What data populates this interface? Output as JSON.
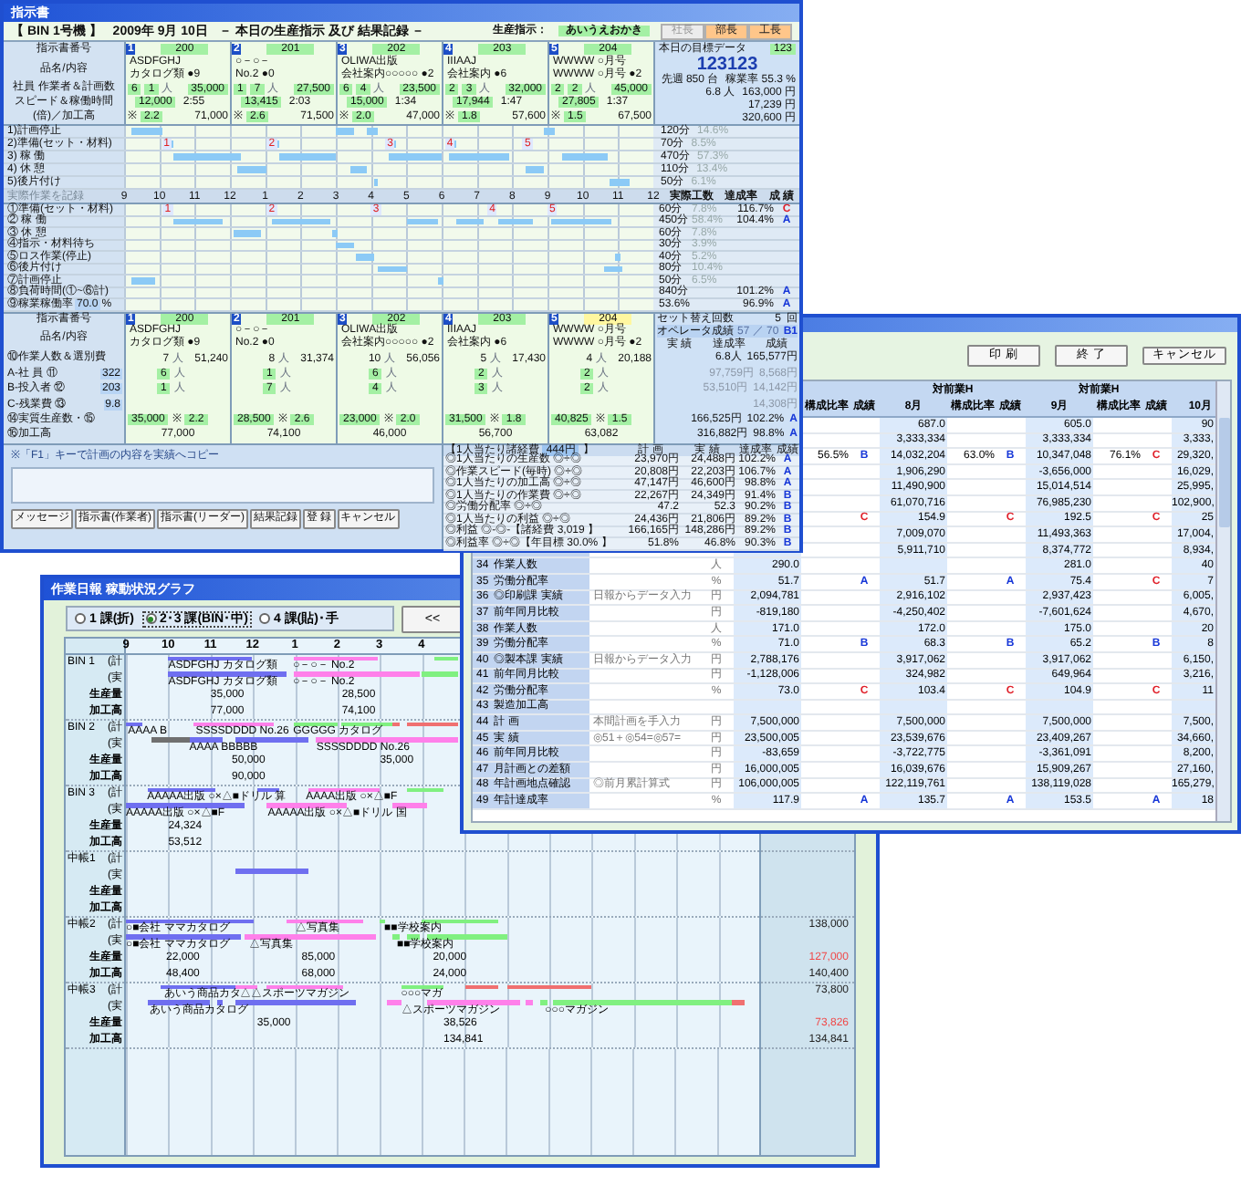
{
  "instruction_window": {
    "title": "指示書",
    "machine": "【 BIN 1号機 】",
    "date": "2009年 9月 10日",
    "heading": "－ 本日の生産指示 及び 結果記録 －",
    "director_label": "生産指示：",
    "director": "あいうえおかき",
    "approvals": [
      {
        "label": "社長",
        "selected": false
      },
      {
        "label": "部長",
        "selected": true
      },
      {
        "label": "工長",
        "selected": true
      }
    ],
    "plan": {
      "labels": [
        "指示書番号",
        "品名/内容",
        "社員 作業者＆計画数",
        "スピード＆稼働時間",
        "(倍)／加工高"
      ],
      "jobs": [
        {
          "no": "1",
          "code": "200",
          "name": [
            "ASDFGHJ",
            "カタログ類 ●9"
          ],
          "staff": "6",
          "workers": "1",
          "unit": "人",
          "quantity": "35,000",
          "speed": "12,000",
          "hours": "2:55",
          "mark": "※",
          "ratio": "2.2",
          "amount": "71,000"
        },
        {
          "no": "2",
          "code": "201",
          "name": [
            "○－○－",
            "No.2 ●0"
          ],
          "staff": "1",
          "workers": "7",
          "unit": "人",
          "quantity": "27,500",
          "speed": "13,415",
          "hours": "2:03",
          "mark": "※",
          "ratio": "2.6",
          "amount": "71,500"
        },
        {
          "no": "3",
          "code": "202",
          "name": [
            "OLIWA出版",
            "会社案内○○○○○ ●2"
          ],
          "staff": "6",
          "workers": "4",
          "unit": "人",
          "quantity": "23,500",
          "speed": "15,000",
          "hours": "1:34",
          "mark": "※",
          "ratio": "2.0",
          "amount": "47,000"
        },
        {
          "no": "4",
          "code": "203",
          "name": [
            "IIIAAJ",
            "会社案内 ●6"
          ],
          "staff": "2",
          "workers": "3",
          "unit": "人",
          "quantity": "32,000",
          "speed": "17,944",
          "hours": "1:47",
          "mark": "※",
          "ratio": "1.8",
          "amount": "57,600"
        },
        {
          "no": "5",
          "code": "204",
          "name": [
            "WWWW ○月号",
            "WWWW ○月号 ●2"
          ],
          "staff": "2",
          "workers": "2",
          "unit": "人",
          "quantity": "45,000",
          "speed": "27,805",
          "hours": "1:37",
          "mark": "※",
          "ratio": "1.5",
          "amount": "67,500"
        }
      ],
      "summary": {
        "label": "本日の目標データ",
        "code": "123",
        "value": "123123",
        "stats": [
          [
            "先週 850 台",
            "稼業率 55.3 %"
          ],
          [
            "6.8 人",
            "163,000 円"
          ],
          [
            "17,239 円"
          ],
          [
            "320,600 円"
          ]
        ]
      },
      "rows": [
        {
          "label": "1)計画停止",
          "minutes": "120分",
          "share": "14.6%"
        },
        {
          "label": "2)準備(セット・材料)",
          "marks": [
            "1",
            "2",
            "3",
            "4",
            "5"
          ],
          "minutes": "70分",
          "share": "8.5%"
        },
        {
          "label": "3) 稼 働",
          "minutes": "470分",
          "share": "57.3%"
        },
        {
          "label": "4) 休 憩",
          "minutes": "110分",
          "share": "13.4%"
        },
        {
          "label": "5)後片付け",
          "minutes": "50分",
          "share": "6.1%"
        }
      ]
    },
    "actual": {
      "label": "実際作業を記録",
      "hours": [
        "9",
        "10",
        "11",
        "12",
        "1",
        "2",
        "3",
        "4",
        "5",
        "6",
        "7",
        "8",
        "9",
        "10",
        "11",
        "12"
      ],
      "columns": [
        "実際工数",
        "達成率",
        "成 績"
      ],
      "rows": [
        {
          "label": "①準備(セット・材料)",
          "marks": [
            "1",
            "2",
            "3",
            "4",
            "5"
          ],
          "minutes": "60分",
          "share": "7.8%",
          "rate": "116.7%",
          "grade": "C",
          "alert": true
        },
        {
          "label": "② 稼 働",
          "minutes": "450分",
          "share": "58.4%",
          "rate": "104.4%",
          "grade": "A",
          "alert": false
        },
        {
          "label": "③ 休 憩",
          "minutes": "60分",
          "share": "7.8%"
        },
        {
          "label": "④指示・材料待ち",
          "minutes": "30分",
          "share": "3.9%"
        },
        {
          "label": "⑤ロス作業(停止)",
          "minutes": "40分",
          "share": "5.2%"
        },
        {
          "label": "⑥後片付け",
          "minutes": "80分",
          "share": "10.4%"
        },
        {
          "label": "⑦計画停止",
          "minutes": "50分",
          "share": "6.5%"
        },
        {
          "label": "⑧負荷時間(①~⑥計)",
          "minutes": "840分",
          "rate": "101.2%",
          "grade": "A",
          "alert": false
        },
        {
          "label": "⑨稼業稼働率",
          "field": "70.0",
          "suffix": "%",
          "minutes": "53.6%",
          "rate": "96.9%",
          "grade": "A",
          "alert": false
        }
      ]
    },
    "result": {
      "labels": [
        "指示書番号",
        "品名/内容"
      ],
      "rows": [
        {
          "label": "⑩作業人数＆選別費"
        },
        {
          "label": "A-社 員 ⑪",
          "field": "322"
        },
        {
          "label": "B-投入者 ⑫",
          "field": "203"
        },
        {
          "label": "C-残業費 ⑬",
          "field": "9.8"
        },
        {
          "label": "⑭実質生産数・⑮"
        },
        {
          "label": "⑯加工高"
        }
      ],
      "jobs": [
        {
          "no": "1",
          "code": "200",
          "highlight": false,
          "name": [
            "ASDFGHJ",
            "カタログ類 ●9"
          ],
          "people": "7",
          "people_unit": "人",
          "cost": "51,240",
          "staff": "6",
          "staff_unit": "人",
          "workers": "1",
          "workers_unit": "人",
          "output": "35,000",
          "mark": "※",
          "ratio": "2.2",
          "amount": "77,000"
        },
        {
          "no": "2",
          "code": "201",
          "highlight": false,
          "name": [
            "○－○－",
            "No.2 ●0"
          ],
          "people": "8",
          "people_unit": "人",
          "cost": "31,374",
          "staff": "1",
          "staff_unit": "人",
          "workers": "7",
          "workers_unit": "人",
          "output": "28,500",
          "mark": "※",
          "ratio": "2.6",
          "amount": "74,100"
        },
        {
          "no": "3",
          "code": "202",
          "highlight": false,
          "name": [
            "OLIWA出版",
            "会社案内○○○○○ ●2"
          ],
          "people": "10",
          "people_unit": "人",
          "cost": "56,056",
          "staff": "6",
          "staff_unit": "人",
          "workers": "4",
          "workers_unit": "人",
          "output": "23,000",
          "mark": "※",
          "ratio": "2.0",
          "amount": "46,000"
        },
        {
          "no": "4",
          "code": "203",
          "highlight": false,
          "name": [
            "IIIAAJ",
            "会社案内 ●6"
          ],
          "people": "5",
          "people_unit": "人",
          "cost": "17,430",
          "staff": "2",
          "staff_unit": "人",
          "workers": "3",
          "workers_unit": "人",
          "output": "31,500",
          "mark": "※",
          "ratio": "1.8",
          "amount": "56,700"
        },
        {
          "no": "5",
          "code": "204",
          "highlight": true,
          "name": [
            "WWWW ○月号",
            "WWWW ○月号 ●2"
          ],
          "people": "4",
          "people_unit": "人",
          "cost": "20,188",
          "staff": "2",
          "staff_unit": "人",
          "workers": "2",
          "workers_unit": "人",
          "output": "40,825",
          "mark": "※",
          "ratio": "1.5",
          "amount": "63,082"
        }
      ],
      "setup_label": "セット替え回数",
      "setup": "5",
      "setup_unit": "回",
      "operator_label": "オペレータ成績",
      "operator": "57 ／ 70",
      "operator_grade": "B1",
      "columns": [
        "実 績",
        "達成率",
        "成績"
      ],
      "summary": [
        {
          "cells": [
            "6.8人",
            "165,577円"
          ],
          "muted": false
        },
        {
          "cells": [
            "97,759円",
            "8,568円"
          ],
          "muted": true
        },
        {
          "cells": [
            "53,510円",
            "14,142円"
          ],
          "muted": true
        },
        {
          "cells": [
            "14,308円"
          ],
          "muted": true
        },
        {
          "cells": [
            "166,525円",
            "102.2%"
          ],
          "grade": "A",
          "muted": false
        },
        {
          "cells": [
            "316,882円",
            "98.8%"
          ],
          "grade": "A",
          "muted": false
        }
      ]
    },
    "memo": {
      "note": "※「F1」キーで計画の内容を実績へコピー"
    },
    "buttons": [
      "メッセージ",
      "指示書(作業者)",
      "指示書(リーダー)",
      "結果記録",
      "登 録",
      "キャンセル"
    ],
    "ratios": {
      "title": "【1人当たり諸経費",
      "overhead": "444円",
      "title_end": "】",
      "columns": [
        "計 画",
        "実 績",
        "達成率",
        "成績"
      ],
      "rows": [
        {
          "label": "◎1人当たりの生産数 ◎÷◎",
          "plan": "23,970円",
          "actual": "24,488円",
          "rate": "102.2%",
          "grade": "A",
          "alert": false
        },
        {
          "label": "◎作業スピード(毎時) ◎÷◎",
          "plan": "20,808円",
          "actual": "22,203円",
          "rate": "106.7%",
          "grade": "A",
          "alert": false
        },
        {
          "label": "◎1人当たりの加工高 ◎÷◎",
          "plan": "47,147円",
          "actual": "46,600円",
          "rate": "98.8%",
          "grade": "A",
          "alert": false
        },
        {
          "label": "◎1人当たりの作業費 ◎÷◎",
          "plan": "22,267円",
          "actual": "24,349円",
          "rate": "91.4%",
          "grade": "B",
          "alert": false
        },
        {
          "label": "◎労働分配率 ◎÷◎",
          "plan": "47.2",
          "actual": "52.3",
          "rate": "90.2%",
          "grade": "B",
          "alert": false
        },
        {
          "label": "◎1人当たりの利益 ◎÷◎",
          "plan": "24,436円",
          "actual": "21,806円",
          "rate": "89.2%",
          "grade": "B",
          "alert": false
        },
        {
          "label": "◎利益 ◎-◎-【諸経費 3,019 】",
          "plan": "166,165円",
          "actual": "148,286円",
          "rate": "89.2%",
          "grade": "B",
          "alert": false
        },
        {
          "label": "◎利益率 ◎÷◎【年目標 30.0% 】",
          "plan": "51.8%",
          "actual": "46.8%",
          "rate": "90.3%",
          "grade": "B",
          "alert": false
        }
      ]
    }
  },
  "report_window": {
    "buttons": [
      "印 刷",
      "終 了",
      "キャンセル"
    ],
    "groups": [
      {
        "ratio_label": "構成比率",
        "grade_label": "成績"
      },
      {
        "title": "対前業H",
        "label": "8月",
        "ratio_label": "構成比率",
        "grade_label": "成績"
      },
      {
        "title": "対前業H",
        "label": "9月",
        "ratio_label": "構成比率",
        "grade_label": "成績"
      },
      {
        "label": "10月"
      }
    ],
    "rows": [
      {
        "cells": [
          {},
          {
            "v": "687.0"
          },
          {
            "v": "605.0"
          },
          {
            "v": "90"
          }
        ]
      },
      {
        "cells": [
          {},
          {
            "v": "3,333,334"
          },
          {
            "v": "3,333,334"
          },
          {
            "v": "3,333,"
          }
        ]
      },
      {
        "cells": [
          {
            "r": "56.5%",
            "g": "B",
            "alert": false
          },
          {
            "v": "14,032,204",
            "r": "63.0%",
            "g": "B",
            "alert": false
          },
          {
            "v": "10,347,048",
            "r": "76.1%",
            "g": "C",
            "alert": true
          },
          {
            "v": "29,320,"
          }
        ]
      },
      {
        "cells": [
          {},
          {
            "v": "1,906,290"
          },
          {
            "v": "-3,656,000"
          },
          {
            "v": "16,029,"
          }
        ]
      },
      {
        "cells": [
          {},
          {
            "v": "11,490,900"
          },
          {
            "v": "15,014,514"
          },
          {
            "v": "25,995,"
          }
        ]
      },
      {
        "cells": [
          {},
          {
            "v": "61,070,716"
          },
          {
            "v": "76,985,230"
          },
          {
            "v": "102,900,"
          }
        ]
      },
      {
        "cells": [
          {
            "g": "C",
            "alert": true
          },
          {
            "v": "154.9",
            "g": "C",
            "alert": true
          },
          {
            "v": "192.5",
            "g": "C",
            "alert": true
          },
          {
            "v": "25"
          }
        ]
      },
      {
        "cells": [
          {},
          {
            "v": "7,009,070"
          },
          {
            "v": "11,493,363"
          },
          {
            "v": "17,004,"
          }
        ]
      },
      {
        "cells": [
          {},
          {
            "v": "5,911,710"
          },
          {
            "v": "8,374,772"
          },
          {
            "v": "8,934,"
          }
        ]
      },
      {
        "no": "34",
        "label": "作業人数",
        "unit": "人",
        "cells": [
          {
            "v": "290.0"
          },
          {},
          {
            "v": "281.0"
          },
          {
            "v": "40"
          }
        ]
      },
      {
        "no": "35",
        "label": "労働分配率",
        "unit": "%",
        "cells": [
          {
            "v": "51.7",
            "g": "A",
            "alert": false
          },
          {
            "v": "51.7",
            "g": "A",
            "alert": false
          },
          {
            "v": "75.4",
            "g": "C",
            "alert": true
          },
          {
            "v": "7"
          }
        ]
      },
      {
        "no": "36",
        "label": "◎印刷課 実績",
        "note": "日報からデータ入力",
        "unit": "円",
        "cells": [
          {
            "v": "2,094,781"
          },
          {
            "v": "2,916,102"
          },
          {
            "v": "2,937,423"
          },
          {
            "v": "6,005,"
          }
        ]
      },
      {
        "no": "37",
        "label": "前年同月比較",
        "unit": "円",
        "cells": [
          {
            "v": "-819,180"
          },
          {
            "v": "-4,250,402"
          },
          {
            "v": "-7,601,624"
          },
          {
            "v": "4,670,"
          }
        ]
      },
      {
        "no": "38",
        "label": "作業人数",
        "unit": "人",
        "cells": [
          {
            "v": "171.0"
          },
          {
            "v": "172.0"
          },
          {
            "v": "175.0"
          },
          {
            "v": "20"
          }
        ]
      },
      {
        "no": "39",
        "label": "労働分配率",
        "unit": "%",
        "cells": [
          {
            "v": "71.0",
            "g": "B",
            "alert": false
          },
          {
            "v": "68.3",
            "g": "B",
            "alert": false
          },
          {
            "v": "65.2",
            "g": "B",
            "alert": false
          },
          {
            "v": "8"
          }
        ]
      },
      {
        "no": "40",
        "label": "◎製本課 実績",
        "note": "日報からデータ入力",
        "unit": "円",
        "cells": [
          {
            "v": "2,788,176"
          },
          {
            "v": "3,917,062"
          },
          {
            "v": "3,917,062"
          },
          {
            "v": "6,150,"
          }
        ]
      },
      {
        "no": "41",
        "label": "前年同月比較",
        "unit": "円",
        "cells": [
          {
            "v": "-1,128,006"
          },
          {
            "v": "324,982"
          },
          {
            "v": "649,964"
          },
          {
            "v": "3,216,"
          }
        ]
      },
      {
        "no": "42",
        "label": "労働分配率",
        "unit": "%",
        "cells": [
          {
            "v": "73.0",
            "g": "C",
            "alert": true
          },
          {
            "v": "103.4",
            "g": "C",
            "alert": true
          },
          {
            "v": "104.9",
            "g": "C",
            "alert": true
          },
          {
            "v": "11"
          }
        ]
      },
      {
        "no": "43",
        "label": "製造加工高",
        "cells": [
          {},
          {},
          {},
          {}
        ]
      },
      {
        "no": "44",
        "label": "計 画",
        "note": "本間計画を手入力",
        "unit": "円",
        "cells": [
          {
            "v": "7,500,000"
          },
          {
            "v": "7,500,000"
          },
          {
            "v": "7,500,000"
          },
          {
            "v": "7,500,"
          }
        ]
      },
      {
        "no": "45",
        "label": "実 績",
        "note": "◎51＋◎54=◎57=",
        "unit": "円",
        "cells": [
          {
            "v": "23,500,005"
          },
          {
            "v": "23,539,676"
          },
          {
            "v": "23,409,267"
          },
          {
            "v": "34,660,"
          }
        ]
      },
      {
        "no": "46",
        "label": "前年同月比較",
        "unit": "円",
        "cells": [
          {
            "v": "-83,659"
          },
          {
            "v": "-3,722,775"
          },
          {
            "v": "-3,361,091"
          },
          {
            "v": "8,200,"
          }
        ]
      },
      {
        "no": "47",
        "label": "月計画との差額",
        "unit": "円",
        "cells": [
          {
            "v": "16,000,005"
          },
          {
            "v": "16,039,676"
          },
          {
            "v": "15,909,267"
          },
          {
            "v": "27,160,"
          }
        ]
      },
      {
        "no": "48",
        "label": "年計画地点確認",
        "note": "◎前月累計算式",
        "unit": "円",
        "cells": [
          {
            "v": "106,000,005"
          },
          {
            "v": "122,119,761"
          },
          {
            "v": "138,119,028"
          },
          {
            "v": "165,279,"
          }
        ]
      },
      {
        "no": "49",
        "label": "年計達成率",
        "unit": "%",
        "cells": [
          {
            "v": "117.9",
            "g": "A",
            "alert": false
          },
          {
            "v": "135.7",
            "g": "A",
            "alert": false
          },
          {
            "v": "153.5",
            "g": "A",
            "alert": false
          },
          {
            "v": "18"
          }
        ]
      }
    ]
  },
  "graph_window": {
    "title": "作業日報 稼動状況グラフ",
    "options": [
      {
        "label": "1 課(折)",
        "selected": false
      },
      {
        "label": "2･3 課(BIN･中)",
        "selected": true
      },
      {
        "label": "4 課(貼)･手",
        "selected": false
      }
    ],
    "back": "<<",
    "hours": [
      "9",
      "10",
      "11",
      "12",
      "1",
      "2",
      "3",
      "4"
    ],
    "groups": [
      {
        "name": "BIN 1",
        "labels": [
          "(計",
          "(実",
          "生産量",
          "加工高"
        ],
        "plan": [
          "ASDFGHJ カタログ類",
          "○－○－ No.2"
        ],
        "actual": [
          "ASDFGHJ カタログ類",
          "○－○－ No.2"
        ],
        "qty": [
          "35,000",
          "28,500"
        ],
        "amount": [
          "77,000",
          "74,100"
        ]
      },
      {
        "name": "BIN 2",
        "labels": [
          "(計",
          "(実",
          "生産量",
          "加工高"
        ],
        "plan": [
          "AAAA B",
          "SSSSDDDD No.26",
          "GGGGG カタログ"
        ],
        "actual": [
          "AAAA BBBBB",
          "SSSSDDDD No.26"
        ],
        "qty": [
          "50,000",
          "35,000"
        ],
        "amount": [
          "90,000"
        ]
      },
      {
        "name": "BIN 3",
        "labels": [
          "(計",
          "(実",
          "生産量",
          "加工高"
        ],
        "plan": [
          "AAAAA出版 ○×△■ドリル 算",
          "AAAA出版 ○×△■F"
        ],
        "actual": [
          "AAAAA出版 ○×△■F",
          "AAAAA出版 ○×△■ドリル 国"
        ],
        "qty": [
          "24,324"
        ],
        "amount": [
          "53,512"
        ]
      },
      {
        "name": "中帳1",
        "labels": [
          "(計",
          "(実",
          "生産量",
          "加工高"
        ]
      },
      {
        "name": "中帳2",
        "labels": [
          "(計",
          "(実",
          "生産量",
          "加工高"
        ],
        "plan": [
          "○■会社 ママカタログ",
          "△写真集",
          "■■学校案内"
        ],
        "actual": [
          "○■会社 ママカタログ",
          "△写真集",
          "■■学校案内"
        ],
        "qty": [
          "22,000",
          "85,000",
          "20,000"
        ],
        "amount": [
          "48,400",
          "68,000",
          "24,000"
        ],
        "totals": {
          "plan": "138,000",
          "qty": "127,000",
          "qty_alert": true,
          "amount": "140,400"
        }
      },
      {
        "name": "中帳3",
        "labels": [
          "(計",
          "(実",
          "生産量",
          "加工高"
        ],
        "plan": [
          "あいう商品カタ",
          "△△スポーツマガジン",
          "○○○マガ"
        ],
        "actual": [
          "あいう商品カタログ",
          "△スポーツマガジン",
          "○○○マガジン"
        ],
        "qty": [
          "35,000",
          "38,526"
        ],
        "amount": [
          "134,841"
        ],
        "totals": {
          "plan": "73,800",
          "qty": "73,826",
          "qty_alert": true,
          "amount": "134,841"
        }
      }
    ]
  }
}
